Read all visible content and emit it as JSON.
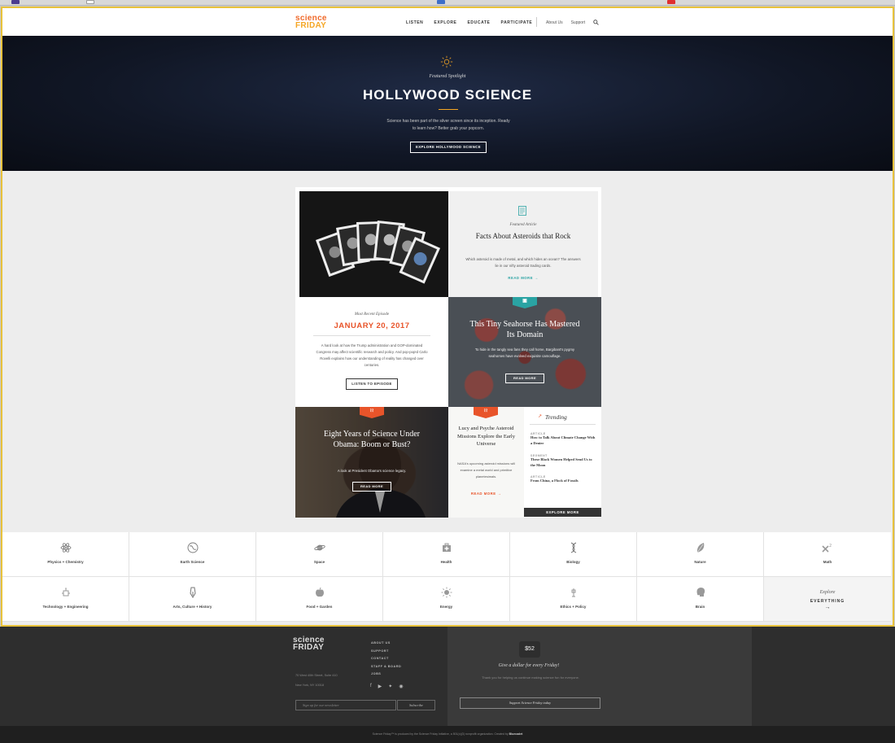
{
  "nav": {
    "logo_line1": "science",
    "logo_line2": "FRIDAY",
    "links": [
      "LISTEN",
      "EXPLORE",
      "EDUCATE",
      "PARTICIPATE"
    ],
    "secondary": [
      "About Us",
      "Support"
    ]
  },
  "hero": {
    "kicker": "Featured Spotlight",
    "title": "HOLLYWOOD SCIENCE",
    "description": "Science has been part of the silver screen since its inception. Ready to learn how? Better grab your popcorn.",
    "button": "EXPLORE HOLLYWOOD SCIENCE"
  },
  "featured": {
    "kicker": "Featured Article",
    "title": "Facts About Asteroids that Rock",
    "description": "Which asteroid is made of metal, and which hides an ocean? The answers lie in our nifty asteroid trading cards.",
    "link": "READ MORE →"
  },
  "episode": {
    "kicker": "Most Recent Episode",
    "date": "JANUARY 20, 2017",
    "description": "A hard look at how the Trump administration and GOP-dominated Congress may affect scientific research and policy. And pop-pop!d Carlo Rovelli explains how our understanding of reality has changed over centuries.",
    "button": "LISTEN TO EPISODE"
  },
  "seahorse": {
    "title": "This Tiny Seahorse Has Mastered Its Domain",
    "description": "To hide in the tangly sea fans they call home, Bargibant's pygmy seahorses have evolved exquisite camouflage.",
    "button": "READ MORE"
  },
  "obama": {
    "title": "Eight Years of Science Under Obama: Boom or Bust?",
    "description": "A look at President Obama's science legacy.",
    "button": "READ MORE"
  },
  "lucy": {
    "title": "Lucy and Psyche Asteroid Missions Explore the Early Universe",
    "description": "NASA's upcoming asteroid missions will examine a metal world and primitive planetesimals.",
    "link": "READ MORE →"
  },
  "trending": {
    "heading": "Trending",
    "items": [
      {
        "type": "ARTICLE",
        "title": "How to Talk About Climate Change With a Denier"
      },
      {
        "type": "SEGMENT",
        "title": "These Black Women Helped Send Us to the Moon"
      },
      {
        "type": "ARTICLE",
        "title": "From China, a Flock of Fossils"
      }
    ],
    "button": "EXPLORE MORE"
  },
  "topics": [
    "Physics + Chemistry",
    "Earth Science",
    "Space",
    "Health",
    "Biology",
    "Nature",
    "Math",
    "Technology + Engineering",
    "Arts, Culture + History",
    "Food + Garden",
    "Energy",
    "Ethics + Policy",
    "Brain"
  ],
  "explore": {
    "line1": "Explore",
    "line2": "EVERYTHING",
    "arrow": "→"
  },
  "footer": {
    "logo_line1": "science",
    "logo_line2": "FRIDAY",
    "address_line1": "70 West 40th Street, Suite 410",
    "address_line2": "New York, NY 10018",
    "links": [
      "ABOUT US",
      "SUPPORT",
      "CONTACT",
      "STAFF & BOARD",
      "JOBS"
    ],
    "newsletter_placeholder": "Sign up for our newsletter",
    "subscribe": "Subscribe",
    "donate_amount": "$52",
    "donate_heading": "Give a dollar for every Friday!",
    "donate_description": "Thank you for helping us continue making science fun for everyone.",
    "donate_button": "Support Science Friday today",
    "legal": "Science Friday™ is produced by the Science Friday Initiative, a 501(c)(3) nonprofit organization. Created by",
    "credit": "Bluecadet"
  },
  "colors": {
    "accent": "#e8542a",
    "brand_orange": "#f06a2a",
    "brand_yellow": "#f5a623",
    "teal": "#2aa3a3"
  }
}
